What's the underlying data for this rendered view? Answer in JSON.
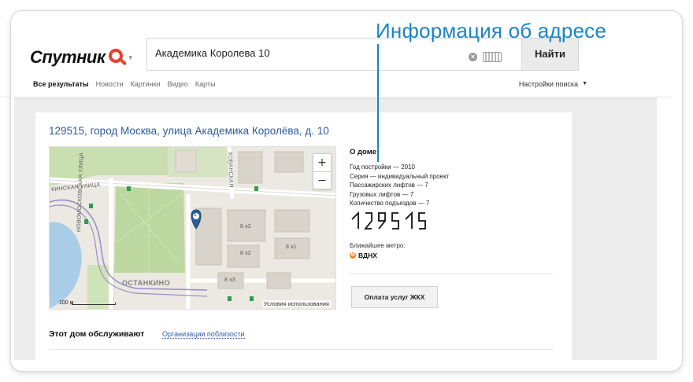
{
  "callout": {
    "text": "Информация об адресе"
  },
  "header": {
    "logo_text": "Спутник",
    "search_value": "Академика Королева 10",
    "search_button": "Найти",
    "icons": [
      "magnifier-logo-icon",
      "clear-icon",
      "keyboard-icon"
    ]
  },
  "nav": {
    "tabs": [
      {
        "label": "Все результаты",
        "active": true
      },
      {
        "label": "Новости",
        "active": false
      },
      {
        "label": "Картинки",
        "active": false
      },
      {
        "label": "Видео",
        "active": false
      },
      {
        "label": "Карты",
        "active": false
      }
    ],
    "settings": "Настройки поиска"
  },
  "result": {
    "address": "129515, город Москва, улица Академика Королёва, д. 10"
  },
  "map": {
    "street_1": "КИНСКАЯ УЛИЦА",
    "street_2": "НОВОМОСКОВСКАЯ УЛИЦА",
    "street_3": "ХОВАНСКАЯ",
    "district": "ОСТАНКИНО",
    "marker_label": "1",
    "scale": "100 м",
    "terms": "Условия использования",
    "zoom_in": "+",
    "zoom_out": "−",
    "building_labels": [
      "8 к2",
      "8 к2",
      "8 к3",
      "8 к1"
    ]
  },
  "house": {
    "title": "О доме",
    "year": "Год постройки — 2010",
    "series": "Серия — индивидуальный проект",
    "passenger_lifts": "Пассажирских лифтов — 7",
    "freight_lifts": "Грузовых лифтов — 7",
    "entrances": "Количество подъездов — 7",
    "postcode": "129515",
    "metro_label": "Ближайшее метро:",
    "metro_icon": "M",
    "metro": "ВДНХ",
    "pay_button": "Оплата услуг ЖКХ"
  },
  "bottom_tabs": {
    "active": "Этот дом обслуживают",
    "link": "Организации поблизости"
  },
  "colors": {
    "accent_blue": "#1a84c8",
    "link_blue": "#2c5a9e",
    "logo_red": "#e8412c",
    "metro_orange": "#f0822d"
  }
}
